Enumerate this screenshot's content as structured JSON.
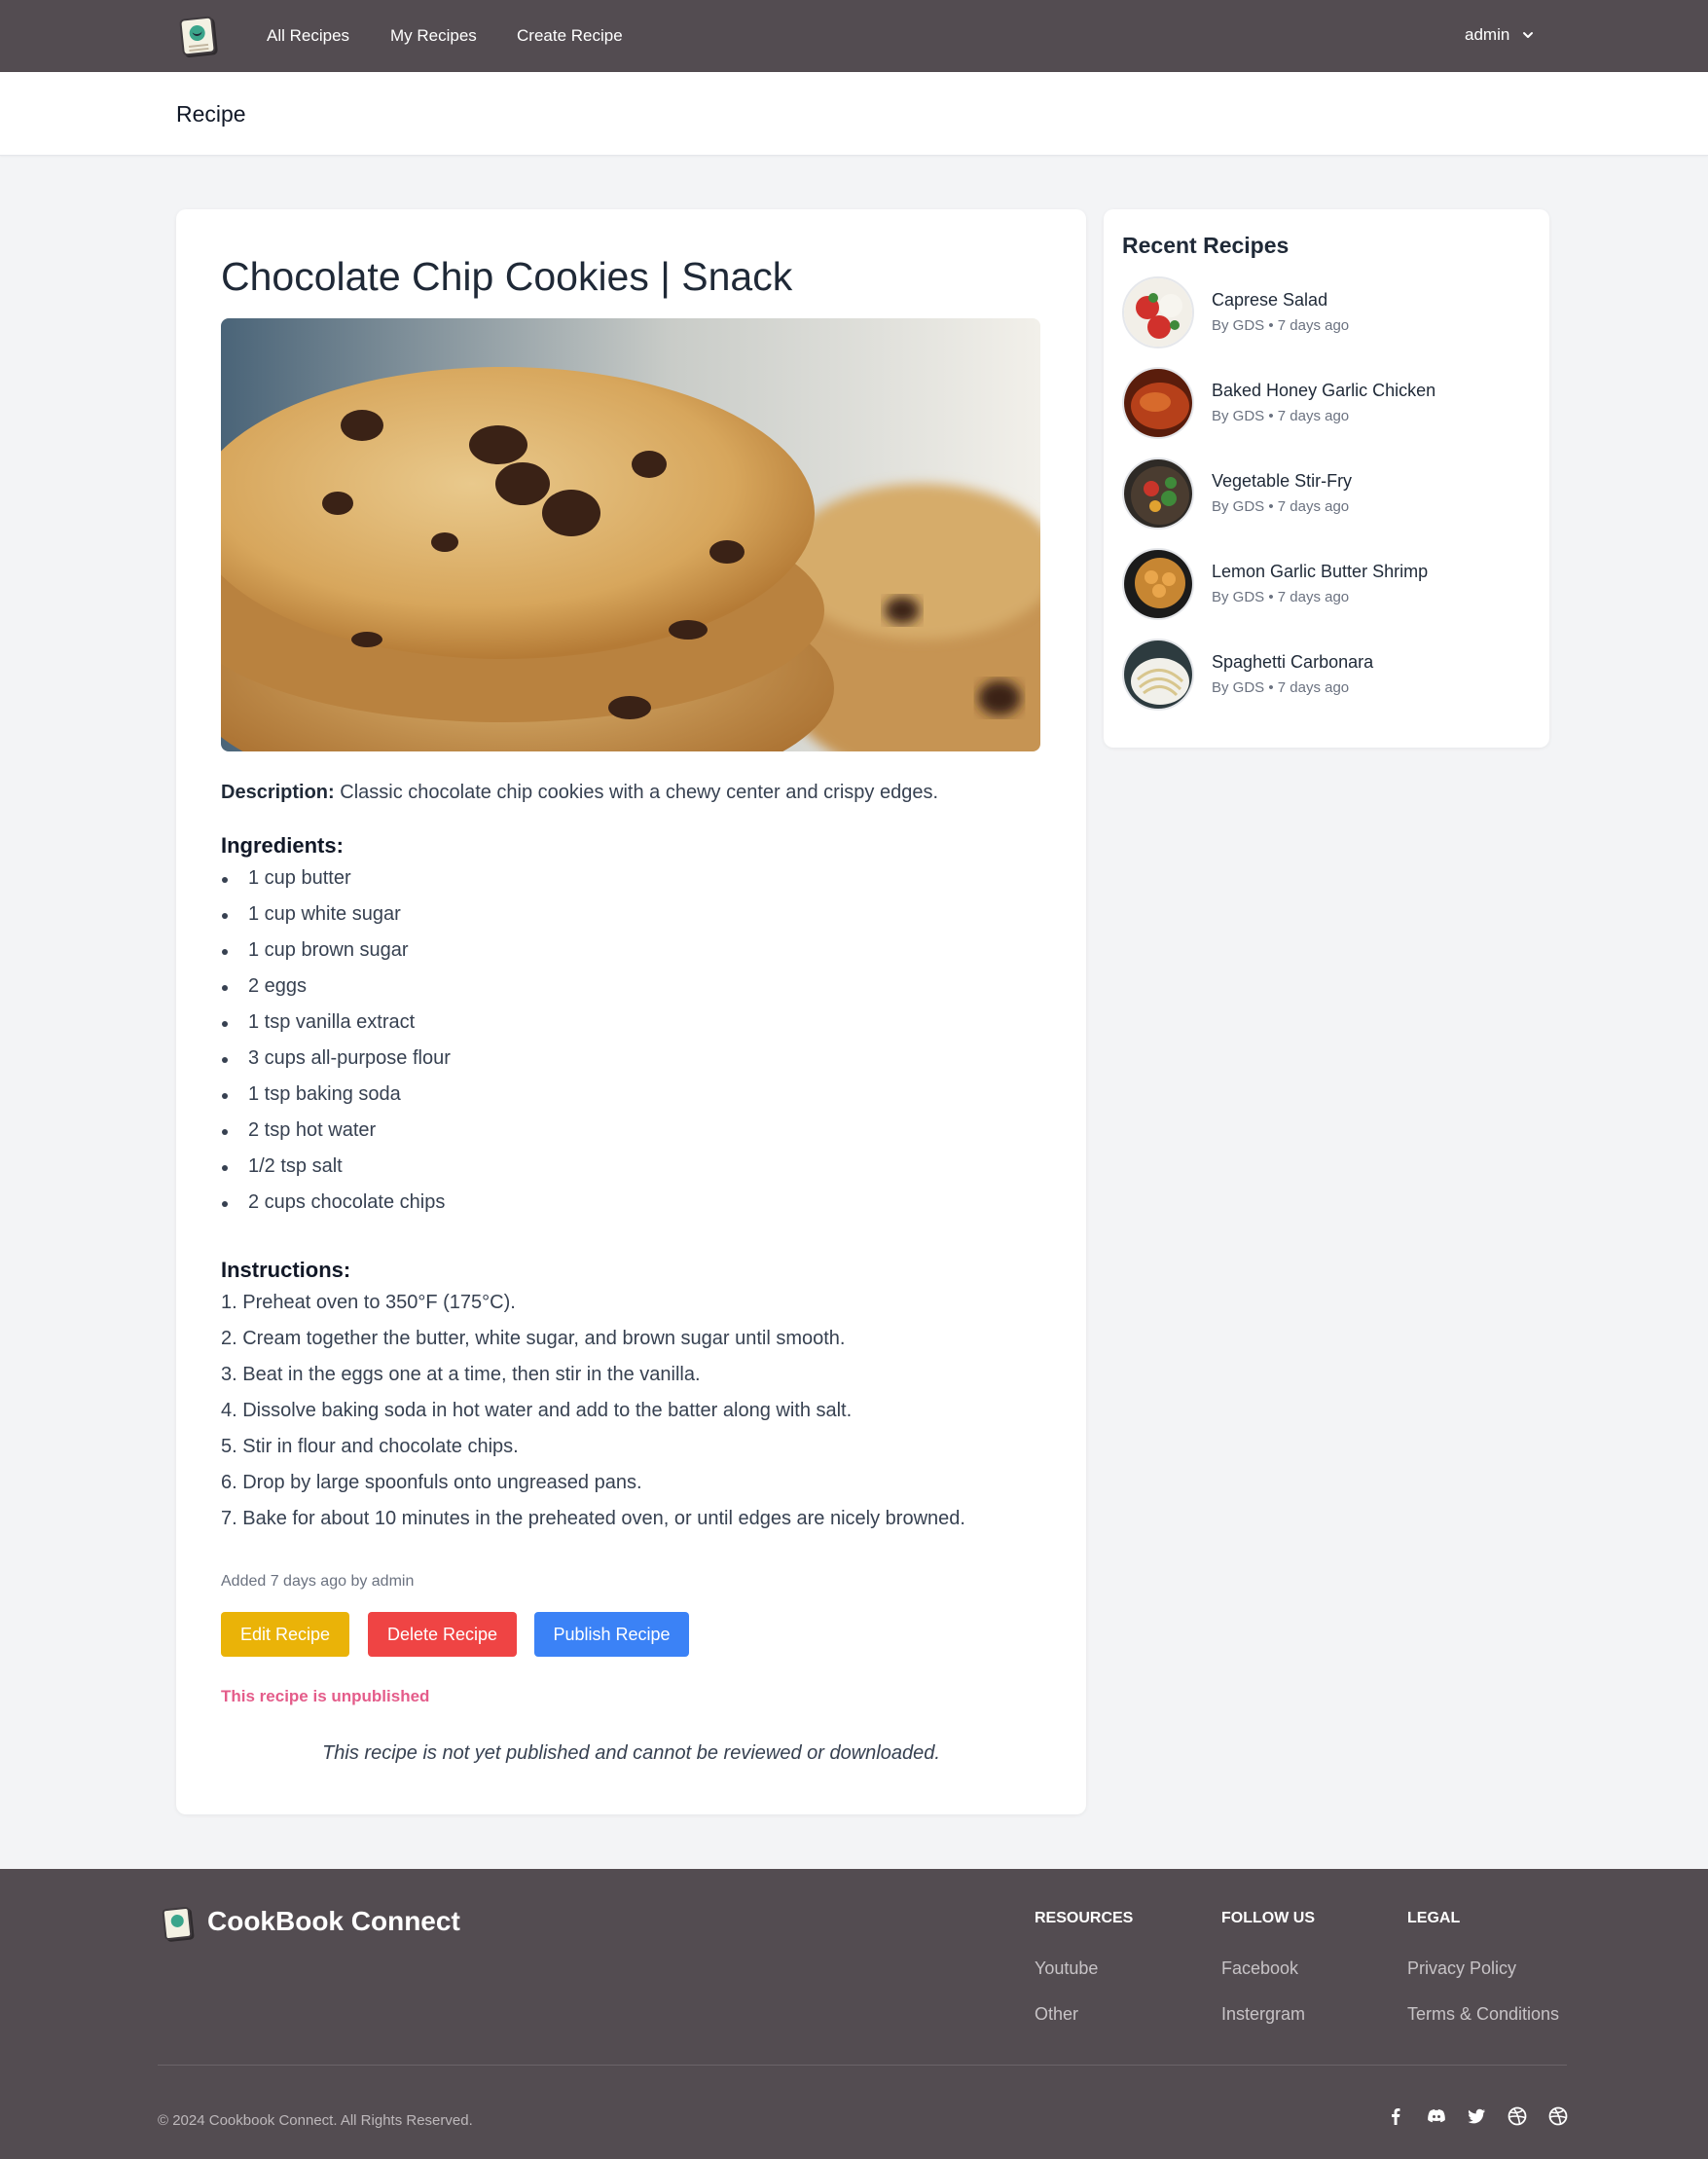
{
  "nav": {
    "links": [
      "All Recipes",
      "My Recipes",
      "Create Recipe"
    ],
    "user": "admin"
  },
  "page_header": {
    "title": "Recipe"
  },
  "recipe": {
    "title": "Chocolate Chip Cookies | Snack",
    "description_label": "Description:",
    "description": "Classic chocolate chip cookies with a chewy center and crispy edges.",
    "ingredients_heading": "Ingredients:",
    "ingredients": [
      "1 cup butter",
      "1 cup white sugar",
      "1 cup brown sugar",
      "2 eggs",
      "1 tsp vanilla extract",
      "3 cups all-purpose flour",
      "1 tsp baking soda",
      "2 tsp hot water",
      "1/2 tsp salt",
      "2 cups chocolate chips"
    ],
    "instructions_heading": "Instructions:",
    "instructions": [
      "1. Preheat oven to 350°F (175°C).",
      "2. Cream together the butter, white sugar, and brown sugar until smooth.",
      "3. Beat in the eggs one at a time, then stir in the vanilla.",
      "4. Dissolve baking soda in hot water and add to the batter along with salt.",
      "5. Stir in flour and chocolate chips.",
      "6. Drop by large spoonfuls onto ungreased pans.",
      "7. Bake for about 10 minutes in the preheated oven, or until edges are nicely browned."
    ],
    "added": "Added 7 days ago by admin",
    "buttons": {
      "edit": "Edit Recipe",
      "delete": "Delete Recipe",
      "publish": "Publish Recipe"
    },
    "status": "This recipe is unpublished",
    "note": "This recipe is not yet published and cannot be reviewed or downloaded."
  },
  "recent": {
    "title": "Recent Recipes",
    "items": [
      {
        "name": "Caprese Salad",
        "meta": "By GDS • 7 days ago"
      },
      {
        "name": "Baked Honey Garlic Chicken",
        "meta": "By GDS • 7 days ago"
      },
      {
        "name": "Vegetable Stir-Fry",
        "meta": "By GDS • 7 days ago"
      },
      {
        "name": "Lemon Garlic Butter Shrimp",
        "meta": "By GDS • 7 days ago"
      },
      {
        "name": "Spaghetti Carbonara",
        "meta": "By GDS • 7 days ago"
      }
    ]
  },
  "footer": {
    "brand": "CookBook Connect",
    "columns": [
      {
        "heading": "RESOURCES",
        "links": [
          "Youtube",
          "Other"
        ]
      },
      {
        "heading": "FOLLOW US",
        "links": [
          "Facebook",
          "Instergram"
        ]
      },
      {
        "heading": "LEGAL",
        "links": [
          "Privacy Policy",
          "Terms & Conditions"
        ]
      }
    ],
    "copyright": "© 2024 Cookbook Connect. All Rights Reserved.",
    "social_icons": [
      "facebook-icon",
      "discord-icon",
      "twitter-icon",
      "dribbble-icon",
      "dribbble-icon"
    ]
  },
  "colors": {
    "nav_bg": "#534c51",
    "edit_btn": "#eab308",
    "delete_btn": "#ef4444",
    "publish_btn": "#3b82f6",
    "status_text": "#e45c8a"
  }
}
